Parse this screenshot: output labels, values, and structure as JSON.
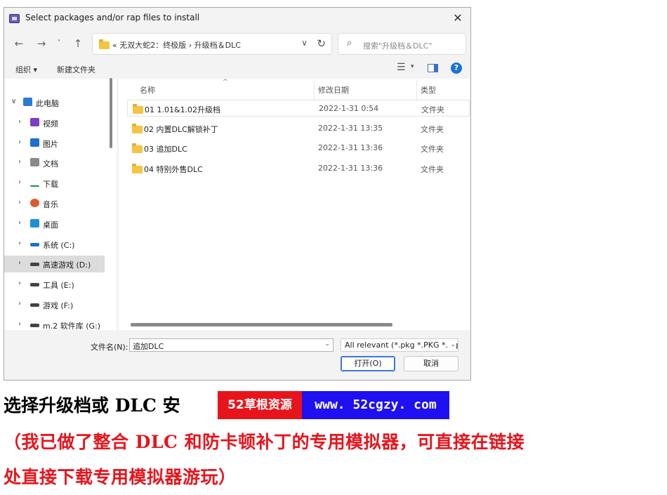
{
  "window": {
    "title": "Select packages and/or rap files to install",
    "close_glyph": "✕"
  },
  "nav": {
    "back_glyph": "←",
    "forward_glyph": "→",
    "recent_glyph": "˅",
    "up_glyph": "↑",
    "address": "«  无双大蛇2：终极版  ›  升级档＆DLC",
    "address_chevron": "∨",
    "refresh_glyph": "↻",
    "search_placeholder": "搜索\"升级档＆DLC\"",
    "search_glyph": "⌕"
  },
  "toolbar": {
    "organize": "组织 ▾",
    "new_folder": "新建文件夹",
    "view_glyph": "☰",
    "view_caret": "▾",
    "help": "?"
  },
  "tree": [
    {
      "label": "此电脑",
      "chevron": "∨",
      "icon": "computer-icon",
      "color": "#2b7bd9",
      "level": 0
    },
    {
      "label": "视频",
      "chevron": "›",
      "icon": "video-icon",
      "color": "#7b3fc4",
      "level": 1
    },
    {
      "label": "图片",
      "chevron": "›",
      "icon": "pictures-icon",
      "color": "#1f6fd0",
      "level": 1
    },
    {
      "label": "文档",
      "chevron": "›",
      "icon": "documents-icon",
      "color": "#8a8a8a",
      "level": 1
    },
    {
      "label": "下载",
      "chevron": "›",
      "icon": "download-icon",
      "color": "#1a8f4a",
      "level": 1
    },
    {
      "label": "音乐",
      "chevron": "›",
      "icon": "music-icon",
      "color": "#e05a2b",
      "level": 1
    },
    {
      "label": "桌面",
      "chevron": "›",
      "icon": "desktop-icon",
      "color": "#1e8fd6",
      "level": 1
    },
    {
      "label": "系统 (C:)",
      "chevron": "›",
      "icon": "drive-icon",
      "color": "#1f6fd0",
      "level": 1
    },
    {
      "label": "高速游戏 (D:)",
      "chevron": "›",
      "icon": "drive-icon",
      "color": "#444444",
      "level": 1,
      "selected": true
    },
    {
      "label": "工具 (E:)",
      "chevron": "›",
      "icon": "drive-icon",
      "color": "#444444",
      "level": 1
    },
    {
      "label": "游戏 (F:)",
      "chevron": "›",
      "icon": "drive-icon",
      "color": "#444444",
      "level": 1
    },
    {
      "label": "m.2 软件库 (G:)",
      "chevron": "›",
      "icon": "drive-icon",
      "color": "#444444",
      "level": 1
    }
  ],
  "columns": {
    "name": "名称",
    "date": "修改日期",
    "type": "类型",
    "sort_glyph": "^"
  },
  "files": [
    {
      "name": "01 1.01&1.02升级档",
      "date": "2022-1-31 0:54",
      "type": "文件夹"
    },
    {
      "name": "02 内置DLC解锁补丁",
      "date": "2022-1-31 13:35",
      "type": "文件夹"
    },
    {
      "name": "03 追加DLC",
      "date": "2022-1-31 13:36",
      "type": "文件夹"
    },
    {
      "name": "04 特别外售DLC",
      "date": "2022-1-31 13:36",
      "type": "文件夹"
    }
  ],
  "bottom": {
    "filename_label": "文件名(N):",
    "filename_value": "追加DLC",
    "dropdown_glyph": "⌄",
    "filter": "All relevant (*.pkg *.PKG *.rap",
    "open_button": "打开(O)",
    "cancel_button": "取消"
  },
  "captions": {
    "line1": "选择升级档或 DLC 安",
    "banner_left": "52草根资源",
    "banner_right": "www. 52cgzy. com",
    "line2": "（我已做了整合 DLC 和防卡顿补丁的专用模拟器，可直接在链接",
    "line3": "处直接下载专用模拟器游玩）"
  },
  "colors": {
    "accent": "#3b78d8",
    "caption_red": "#e8141c",
    "banner_blue": "#1e10f0",
    "folder": "#f5c445"
  }
}
